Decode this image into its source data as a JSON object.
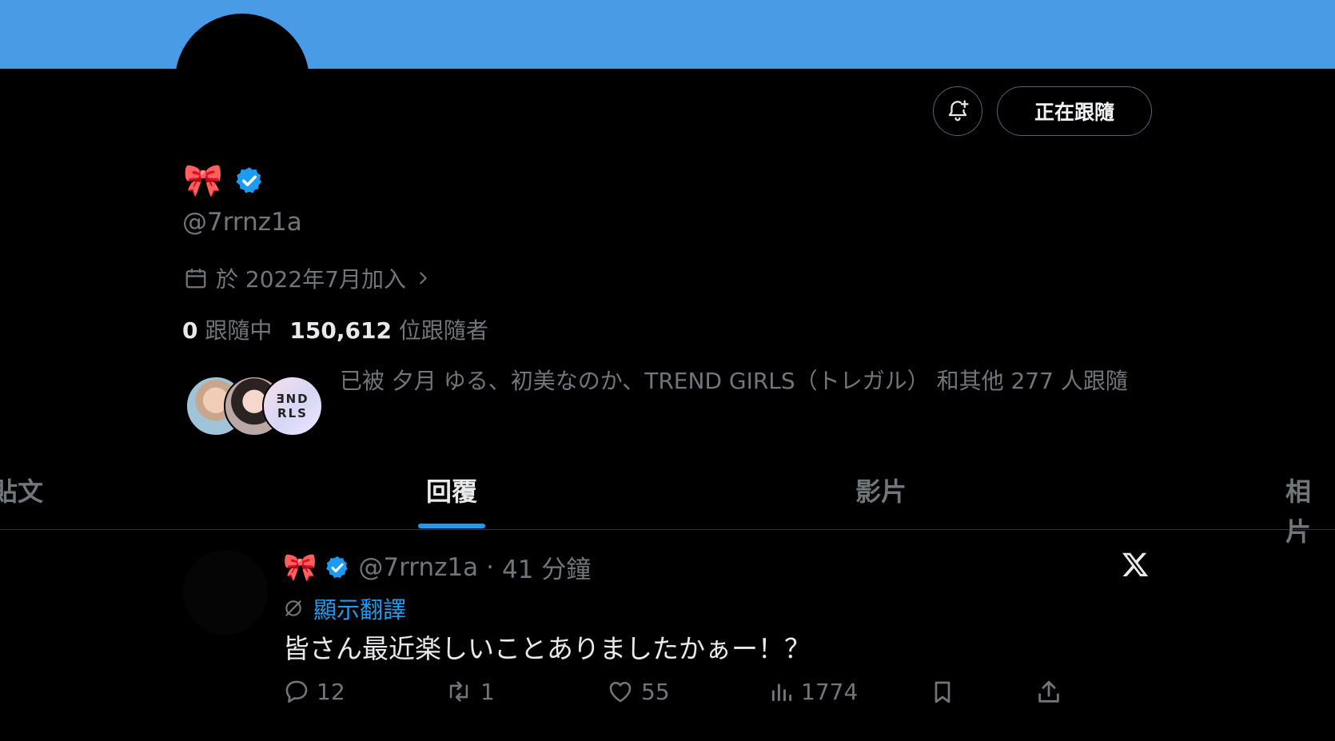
{
  "header": {
    "follow_button_label": "正在跟隨",
    "notify_icon": "bell-plus-icon"
  },
  "profile": {
    "display_name_emoji": "🎀",
    "handle": "@7rrnz1a",
    "verified": true,
    "joined_text": "於 2022年7月加入",
    "following_count": "0",
    "following_label": "跟隨中",
    "followers_count": "150,612",
    "followers_label": "位跟隨者",
    "followed_by_text": "已被 夕月 ゆる、初美なのか、TREND GIRLS（トレガル） 和其他 277 人跟隨",
    "followed_by_avatar3_text": "ƎND RLS"
  },
  "tabs": [
    {
      "label": "貼文"
    },
    {
      "label": "回覆",
      "active": true
    },
    {
      "label": "影片"
    },
    {
      "label": "相片"
    }
  ],
  "tweet": {
    "name_emoji": "🎀",
    "handle": "@7rrnz1a",
    "separator": "·",
    "time": "41 分鐘",
    "translate_label": "顯示翻譯",
    "text": "皆さん最近楽しいことありましたかぁー！？",
    "replies": "12",
    "reposts": "1",
    "likes": "55",
    "views": "1774"
  },
  "colors": {
    "banner": "#4a9be6",
    "accent": "#1d9bf0",
    "muted": "#71767b",
    "background": "#000000"
  }
}
